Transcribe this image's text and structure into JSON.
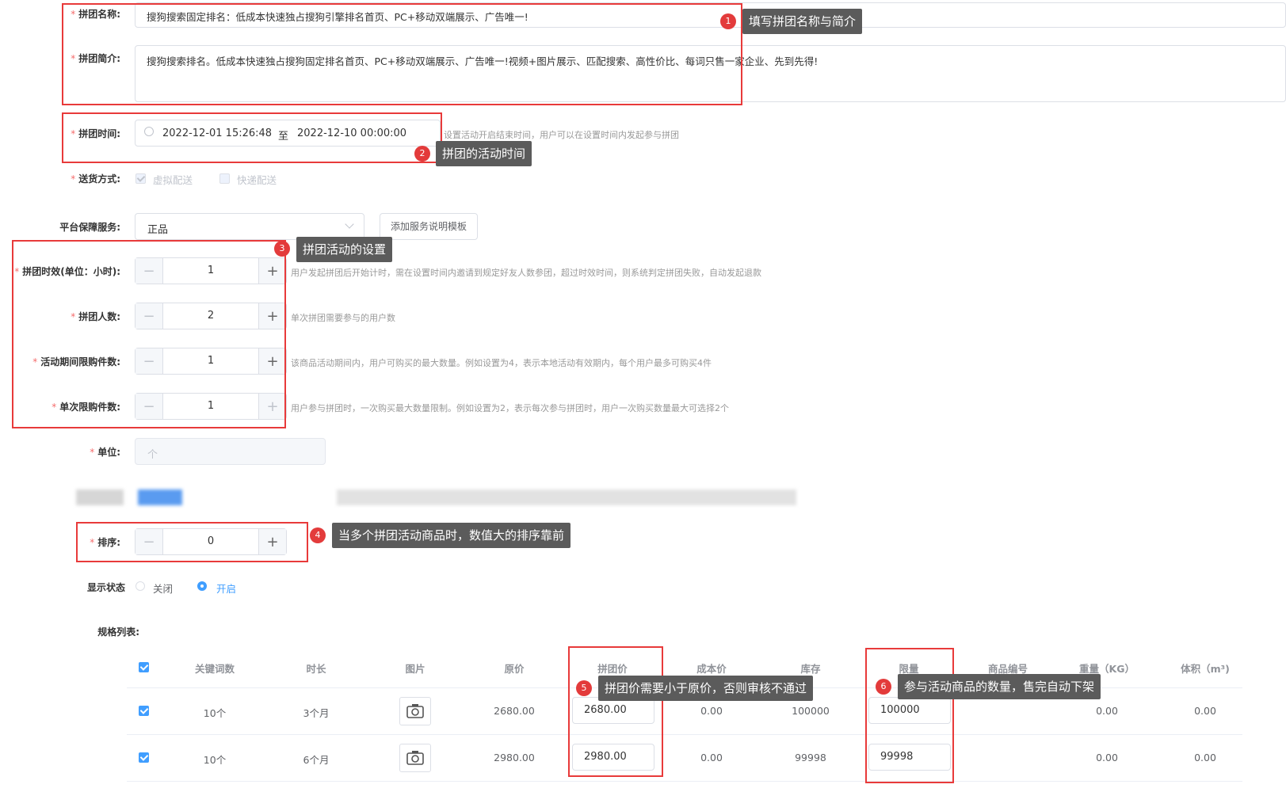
{
  "form": {
    "name": {
      "label": "拼团名称:",
      "value": "搜狗搜索固定排名：低成本快速独占搜狗引擎排名首页、PC+移动双端展示、广告唯一!"
    },
    "intro": {
      "label": "拼团简介:",
      "value": "搜狗搜索排名。低成本快速独占搜狗固定排名首页、PC+移动双端展示、广告唯一!视频+图片展示、匹配搜索、高性价比、每词只售一家企业、先到先得!"
    },
    "time": {
      "label": "拼团时间:",
      "start": "2022-12-01 15:26:48",
      "sep": "至",
      "end": "2022-12-10 00:00:00",
      "hint": "设置活动开启结束时间，用户可以在设置时间内发起参与拼团"
    },
    "delivery": {
      "label": "送货方式:",
      "options": [
        "虚拟配送",
        "快递配送"
      ]
    },
    "service": {
      "label": "平台保障服务:",
      "selected": "正品",
      "add_button": "添加服务说明模板"
    },
    "validity": {
      "label": "拼团时效(单位：小时):",
      "value": "1",
      "hint": "用户发起拼团后开始计时，需在设置时间内邀请到规定好友人数参团，超过时效时间，则系统判定拼团失败，自动发起退款"
    },
    "people": {
      "label": "拼团人数:",
      "value": "2",
      "hint": "单次拼团需要参与的用户数"
    },
    "limit_total": {
      "label": "活动期间限购件数:",
      "value": "1",
      "hint": "该商品活动期间内，用户可购买的最大数量。例如设置为4，表示本地活动有效期内，每个用户最多可购买4件"
    },
    "limit_once": {
      "label": "单次限购件数:",
      "value": "1",
      "hint": "用户参与拼团时，一次购买最大数量限制。例如设置为2，表示每次参与拼团时，用户一次购买数量最大可选择2个"
    },
    "unit": {
      "label": "单位:",
      "placeholder": "个"
    },
    "sort": {
      "label": "排序:",
      "value": "0"
    },
    "display": {
      "label": "显示状态",
      "off": "关闭",
      "on": "开启"
    },
    "spec_label": "规格列表:"
  },
  "table": {
    "headers": [
      "关键词数",
      "时长",
      "图片",
      "原价",
      "拼团价",
      "成本价",
      "库存",
      "限量",
      "商品编号",
      "重量（KG）",
      "体积（m³)"
    ],
    "rows": [
      {
        "keywords": "10个",
        "duration": "3个月",
        "price": "2680.00",
        "group_price": "2680.00",
        "cost": "0.00",
        "stock": "100000",
        "limit": "100000",
        "weight": "0.00",
        "volume": "0.00"
      },
      {
        "keywords": "10个",
        "duration": "6个月",
        "price": "2980.00",
        "group_price": "2980.00",
        "cost": "0.00",
        "stock": "99998",
        "limit": "99998",
        "weight": "0.00",
        "volume": "0.00"
      }
    ]
  },
  "annotations": [
    {
      "num": "1",
      "text": "填写拼团名称与简介"
    },
    {
      "num": "2",
      "text": "拼团的活动时间"
    },
    {
      "num": "3",
      "text": "拼团活动的设置"
    },
    {
      "num": "4",
      "text": "当多个拼团活动商品时，数值大的排序靠前"
    },
    {
      "num": "5",
      "text": "拼团价需要小于原价，否则审核不通过"
    },
    {
      "num": "6",
      "text": "参与活动商品的数量，售完自动下架"
    }
  ],
  "colors": {
    "accent": "#409eff",
    "annotation_red": "#e83a3a",
    "required": "#f56c6c"
  }
}
